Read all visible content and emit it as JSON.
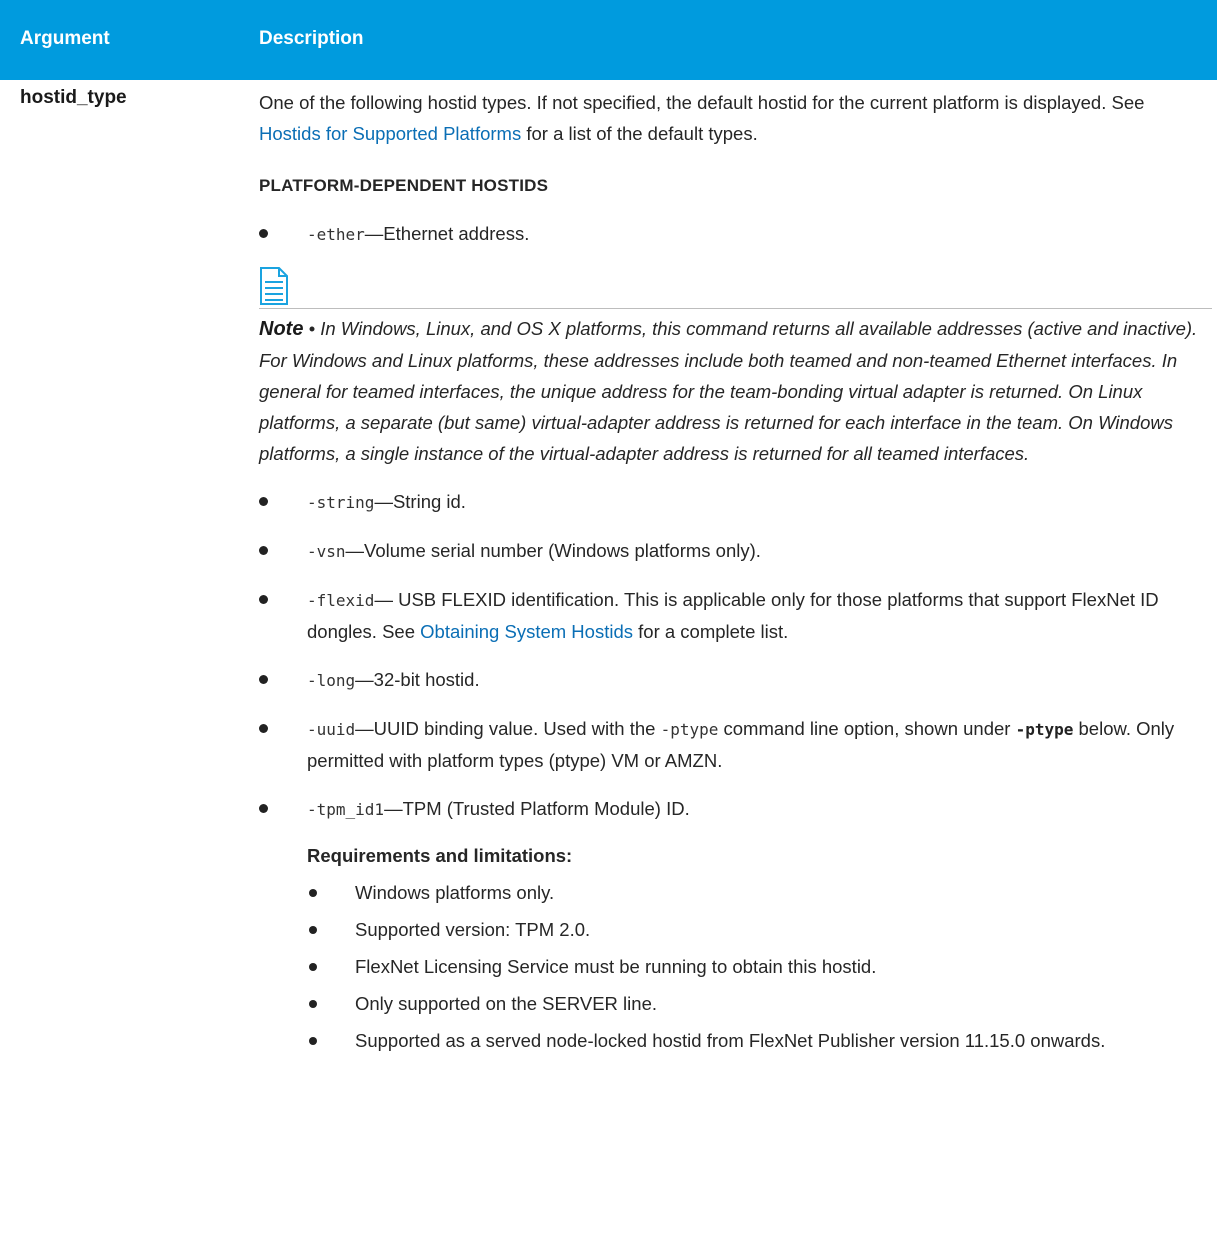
{
  "table": {
    "header": {
      "argument": "Argument",
      "description": "Description"
    },
    "argument_name": "hostid_type",
    "intro": {
      "text1": "One of the following hostid types. If not specified, the default hostid for the current platform is displayed. See ",
      "link": "Hostids for Supported Platforms",
      "text2": " for a list of the default types."
    },
    "subheading": "PLATFORM-DEPENDENT HOSTIDS",
    "ether": {
      "code": "-ether",
      "text": "—Ethernet address."
    },
    "note": {
      "label": "Note",
      "bullet": " • ",
      "text": "In Windows, Linux, and OS X platforms, this command returns all available addresses (active and inactive). For Windows and Linux platforms, these addresses include both teamed and non-teamed Ethernet interfaces. In general for teamed interfaces, the unique address for the team-bonding virtual adapter is returned. On Linux platforms, a separate (but same) virtual-adapter address is returned for each interface in the team. On Windows platforms, a single instance of the virtual-adapter address is returned for all teamed interfaces."
    },
    "string": {
      "code": "-string",
      "text": "—String id."
    },
    "vsn": {
      "code": "-vsn",
      "text": "—Volume serial number (Windows platforms only)."
    },
    "flexid": {
      "code": "-flexid",
      "text1": "— USB FLEXID identification. This is applicable only for those platforms that support FlexNet ID dongles. See ",
      "link": "Obtaining System Hostids",
      "text2": " for a complete list."
    },
    "long": {
      "code": "-long",
      "text": "—32-bit hostid."
    },
    "uuid": {
      "code": "-uuid",
      "text1": "—UUID binding value. Used with the ",
      "code2": "-ptype",
      "text2": " command line option, shown under ",
      "code3": "-ptype",
      "text3": " below. Only permitted with platform types (ptype) VM or AMZN."
    },
    "tpm": {
      "code": "-tpm_id1",
      "text": "—TPM (Trusted Platform Module) ID.",
      "req_heading": "Requirements and limitations:",
      "requirements": [
        "Windows platforms only.",
        "Supported version: TPM 2.0.",
        "FlexNet Licensing Service must be running to obtain this hostid.",
        "Only supported on the SERVER line.",
        "Supported as a served node-locked hostid from FlexNet Publisher version 11.15.0 onwards."
      ]
    }
  },
  "colors": {
    "header_bg": "#009bde",
    "link": "#0a6eb5",
    "icon": "#1aa3e0"
  },
  "icons": {
    "note": "note-document-icon"
  }
}
